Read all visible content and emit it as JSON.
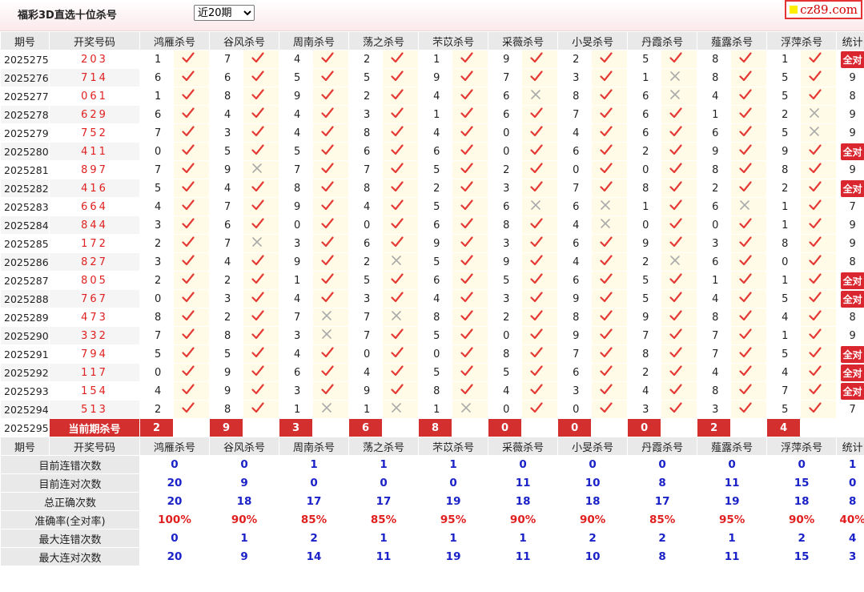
{
  "header": {
    "title": "福彩3D直选十位杀号",
    "period_select": "近20期",
    "logo_text": "cz89.com"
  },
  "columns": [
    "期号",
    "开奖号码",
    "鸿雁杀号",
    "谷风杀号",
    "周南杀号",
    "荡之杀号",
    "芣苡杀号",
    "采薇杀号",
    "小旻杀号",
    "丹霞杀号",
    "薤露杀号",
    "浮萍杀号",
    "统计"
  ],
  "experts": [
    "鸿雁",
    "谷风",
    "周南",
    "荡之",
    "芣苡",
    "采薇",
    "小旻",
    "丹霞",
    "薤露",
    "浮萍"
  ],
  "rows": [
    {
      "period": "2025275",
      "number": "203",
      "kills": [
        [
          "1",
          1
        ],
        [
          "7",
          1
        ],
        [
          "4",
          1
        ],
        [
          "2",
          1
        ],
        [
          "1",
          1
        ],
        [
          "9",
          1
        ],
        [
          "2",
          1
        ],
        [
          "5",
          1
        ],
        [
          "8",
          1
        ],
        [
          "1",
          1
        ]
      ],
      "stat": "全对"
    },
    {
      "period": "2025276",
      "number": "714",
      "kills": [
        [
          "6",
          1
        ],
        [
          "6",
          1
        ],
        [
          "5",
          1
        ],
        [
          "5",
          1
        ],
        [
          "9",
          1
        ],
        [
          "7",
          1
        ],
        [
          "3",
          1
        ],
        [
          "1",
          0
        ],
        [
          "8",
          1
        ],
        [
          "5",
          1
        ]
      ],
      "stat": "9"
    },
    {
      "period": "2025277",
      "number": "061",
      "kills": [
        [
          "1",
          1
        ],
        [
          "8",
          1
        ],
        [
          "9",
          1
        ],
        [
          "2",
          1
        ],
        [
          "4",
          1
        ],
        [
          "6",
          0
        ],
        [
          "8",
          1
        ],
        [
          "6",
          0
        ],
        [
          "4",
          1
        ],
        [
          "5",
          1
        ]
      ],
      "stat": "8"
    },
    {
      "period": "2025278",
      "number": "629",
      "kills": [
        [
          "6",
          1
        ],
        [
          "4",
          1
        ],
        [
          "4",
          1
        ],
        [
          "3",
          1
        ],
        [
          "1",
          1
        ],
        [
          "6",
          1
        ],
        [
          "7",
          1
        ],
        [
          "6",
          1
        ],
        [
          "1",
          1
        ],
        [
          "2",
          0
        ]
      ],
      "stat": "9"
    },
    {
      "period": "2025279",
      "number": "752",
      "kills": [
        [
          "7",
          1
        ],
        [
          "3",
          1
        ],
        [
          "4",
          1
        ],
        [
          "8",
          1
        ],
        [
          "4",
          1
        ],
        [
          "0",
          1
        ],
        [
          "4",
          1
        ],
        [
          "6",
          1
        ],
        [
          "6",
          1
        ],
        [
          "5",
          0
        ]
      ],
      "stat": "9"
    },
    {
      "period": "2025280",
      "number": "411",
      "kills": [
        [
          "0",
          1
        ],
        [
          "5",
          1
        ],
        [
          "5",
          1
        ],
        [
          "6",
          1
        ],
        [
          "6",
          1
        ],
        [
          "0",
          1
        ],
        [
          "6",
          1
        ],
        [
          "2",
          1
        ],
        [
          "9",
          1
        ],
        [
          "9",
          1
        ]
      ],
      "stat": "全对"
    },
    {
      "period": "2025281",
      "number": "897",
      "kills": [
        [
          "7",
          1
        ],
        [
          "9",
          0
        ],
        [
          "7",
          1
        ],
        [
          "7",
          1
        ],
        [
          "5",
          1
        ],
        [
          "2",
          1
        ],
        [
          "0",
          1
        ],
        [
          "0",
          1
        ],
        [
          "8",
          1
        ],
        [
          "8",
          1
        ]
      ],
      "stat": "9"
    },
    {
      "period": "2025282",
      "number": "416",
      "kills": [
        [
          "5",
          1
        ],
        [
          "4",
          1
        ],
        [
          "8",
          1
        ],
        [
          "8",
          1
        ],
        [
          "2",
          1
        ],
        [
          "3",
          1
        ],
        [
          "7",
          1
        ],
        [
          "8",
          1
        ],
        [
          "2",
          1
        ],
        [
          "2",
          1
        ]
      ],
      "stat": "全对"
    },
    {
      "period": "2025283",
      "number": "664",
      "kills": [
        [
          "4",
          1
        ],
        [
          "7",
          1
        ],
        [
          "9",
          1
        ],
        [
          "4",
          1
        ],
        [
          "5",
          1
        ],
        [
          "6",
          0
        ],
        [
          "6",
          0
        ],
        [
          "1",
          1
        ],
        [
          "6",
          0
        ],
        [
          "1",
          1
        ]
      ],
      "stat": "7"
    },
    {
      "period": "2025284",
      "number": "844",
      "kills": [
        [
          "3",
          1
        ],
        [
          "6",
          1
        ],
        [
          "0",
          1
        ],
        [
          "0",
          1
        ],
        [
          "6",
          1
        ],
        [
          "8",
          1
        ],
        [
          "4",
          0
        ],
        [
          "0",
          1
        ],
        [
          "0",
          1
        ],
        [
          "1",
          1
        ]
      ],
      "stat": "9"
    },
    {
      "period": "2025285",
      "number": "172",
      "kills": [
        [
          "2",
          1
        ],
        [
          "7",
          0
        ],
        [
          "3",
          1
        ],
        [
          "6",
          1
        ],
        [
          "9",
          1
        ],
        [
          "3",
          1
        ],
        [
          "6",
          1
        ],
        [
          "9",
          1
        ],
        [
          "3",
          1
        ],
        [
          "8",
          1
        ]
      ],
      "stat": "9"
    },
    {
      "period": "2025286",
      "number": "827",
      "kills": [
        [
          "3",
          1
        ],
        [
          "4",
          1
        ],
        [
          "9",
          1
        ],
        [
          "2",
          0
        ],
        [
          "5",
          1
        ],
        [
          "9",
          1
        ],
        [
          "4",
          1
        ],
        [
          "2",
          0
        ],
        [
          "6",
          1
        ],
        [
          "0",
          1
        ]
      ],
      "stat": "8"
    },
    {
      "period": "2025287",
      "number": "805",
      "kills": [
        [
          "2",
          1
        ],
        [
          "2",
          1
        ],
        [
          "1",
          1
        ],
        [
          "5",
          1
        ],
        [
          "6",
          1
        ],
        [
          "5",
          1
        ],
        [
          "6",
          1
        ],
        [
          "5",
          1
        ],
        [
          "1",
          1
        ],
        [
          "1",
          1
        ]
      ],
      "stat": "全对"
    },
    {
      "period": "2025288",
      "number": "767",
      "kills": [
        [
          "0",
          1
        ],
        [
          "3",
          1
        ],
        [
          "4",
          1
        ],
        [
          "3",
          1
        ],
        [
          "4",
          1
        ],
        [
          "3",
          1
        ],
        [
          "9",
          1
        ],
        [
          "5",
          1
        ],
        [
          "4",
          1
        ],
        [
          "5",
          1
        ]
      ],
      "stat": "全对"
    },
    {
      "period": "2025289",
      "number": "473",
      "kills": [
        [
          "8",
          1
        ],
        [
          "2",
          1
        ],
        [
          "7",
          0
        ],
        [
          "7",
          0
        ],
        [
          "8",
          1
        ],
        [
          "2",
          1
        ],
        [
          "8",
          1
        ],
        [
          "9",
          1
        ],
        [
          "8",
          1
        ],
        [
          "4",
          1
        ]
      ],
      "stat": "8"
    },
    {
      "period": "2025290",
      "number": "332",
      "kills": [
        [
          "7",
          1
        ],
        [
          "8",
          1
        ],
        [
          "3",
          0
        ],
        [
          "7",
          1
        ],
        [
          "5",
          1
        ],
        [
          "0",
          1
        ],
        [
          "9",
          1
        ],
        [
          "7",
          1
        ],
        [
          "7",
          1
        ],
        [
          "1",
          1
        ]
      ],
      "stat": "9"
    },
    {
      "period": "2025291",
      "number": "794",
      "kills": [
        [
          "5",
          1
        ],
        [
          "5",
          1
        ],
        [
          "4",
          1
        ],
        [
          "0",
          1
        ],
        [
          "0",
          1
        ],
        [
          "8",
          1
        ],
        [
          "7",
          1
        ],
        [
          "8",
          1
        ],
        [
          "7",
          1
        ],
        [
          "5",
          1
        ]
      ],
      "stat": "全对"
    },
    {
      "period": "2025292",
      "number": "117",
      "kills": [
        [
          "0",
          1
        ],
        [
          "9",
          1
        ],
        [
          "6",
          1
        ],
        [
          "4",
          1
        ],
        [
          "5",
          1
        ],
        [
          "5",
          1
        ],
        [
          "6",
          1
        ],
        [
          "2",
          1
        ],
        [
          "4",
          1
        ],
        [
          "4",
          1
        ]
      ],
      "stat": "全对"
    },
    {
      "period": "2025293",
      "number": "154",
      "kills": [
        [
          "4",
          1
        ],
        [
          "9",
          1
        ],
        [
          "3",
          1
        ],
        [
          "9",
          1
        ],
        [
          "8",
          1
        ],
        [
          "4",
          1
        ],
        [
          "3",
          1
        ],
        [
          "4",
          1
        ],
        [
          "8",
          1
        ],
        [
          "7",
          1
        ]
      ],
      "stat": "全对"
    },
    {
      "period": "2025294",
      "number": "513",
      "kills": [
        [
          "2",
          1
        ],
        [
          "8",
          1
        ],
        [
          "1",
          0
        ],
        [
          "1",
          0
        ],
        [
          "1",
          0
        ],
        [
          "0",
          1
        ],
        [
          "0",
          1
        ],
        [
          "3",
          1
        ],
        [
          "3",
          1
        ],
        [
          "5",
          1
        ]
      ],
      "stat": "7"
    }
  ],
  "current": {
    "period": "2025295",
    "label": "当前期杀号",
    "kills": [
      "2",
      "9",
      "3",
      "6",
      "8",
      "0",
      "0",
      "0",
      "2",
      "4"
    ]
  },
  "stats": [
    {
      "label": "目前连错次数",
      "values": [
        "0",
        "0",
        "1",
        "1",
        "1",
        "0",
        "0",
        "0",
        "0",
        "0",
        "1"
      ]
    },
    {
      "label": "目前连对次数",
      "values": [
        "20",
        "9",
        "0",
        "0",
        "0",
        "11",
        "10",
        "8",
        "11",
        "15",
        "0"
      ]
    },
    {
      "label": "总正确次数",
      "values": [
        "20",
        "18",
        "17",
        "17",
        "19",
        "18",
        "18",
        "17",
        "19",
        "18",
        "8"
      ]
    },
    {
      "label": "准确率(全对率)",
      "values": [
        "100%",
        "90%",
        "85%",
        "85%",
        "95%",
        "90%",
        "90%",
        "85%",
        "95%",
        "90%",
        "40%"
      ]
    },
    {
      "label": "最大连错次数",
      "values": [
        "0",
        "1",
        "2",
        "1",
        "1",
        "1",
        "2",
        "2",
        "1",
        "2",
        "4"
      ]
    },
    {
      "label": "最大连对次数",
      "values": [
        "20",
        "9",
        "14",
        "11",
        "19",
        "11",
        "10",
        "8",
        "11",
        "15",
        "3"
      ]
    }
  ],
  "colors": {
    "accent": "#d32f2f",
    "check": "#e53935",
    "cross": "#aaaaaa",
    "stat_blue": "#1a22c8"
  }
}
